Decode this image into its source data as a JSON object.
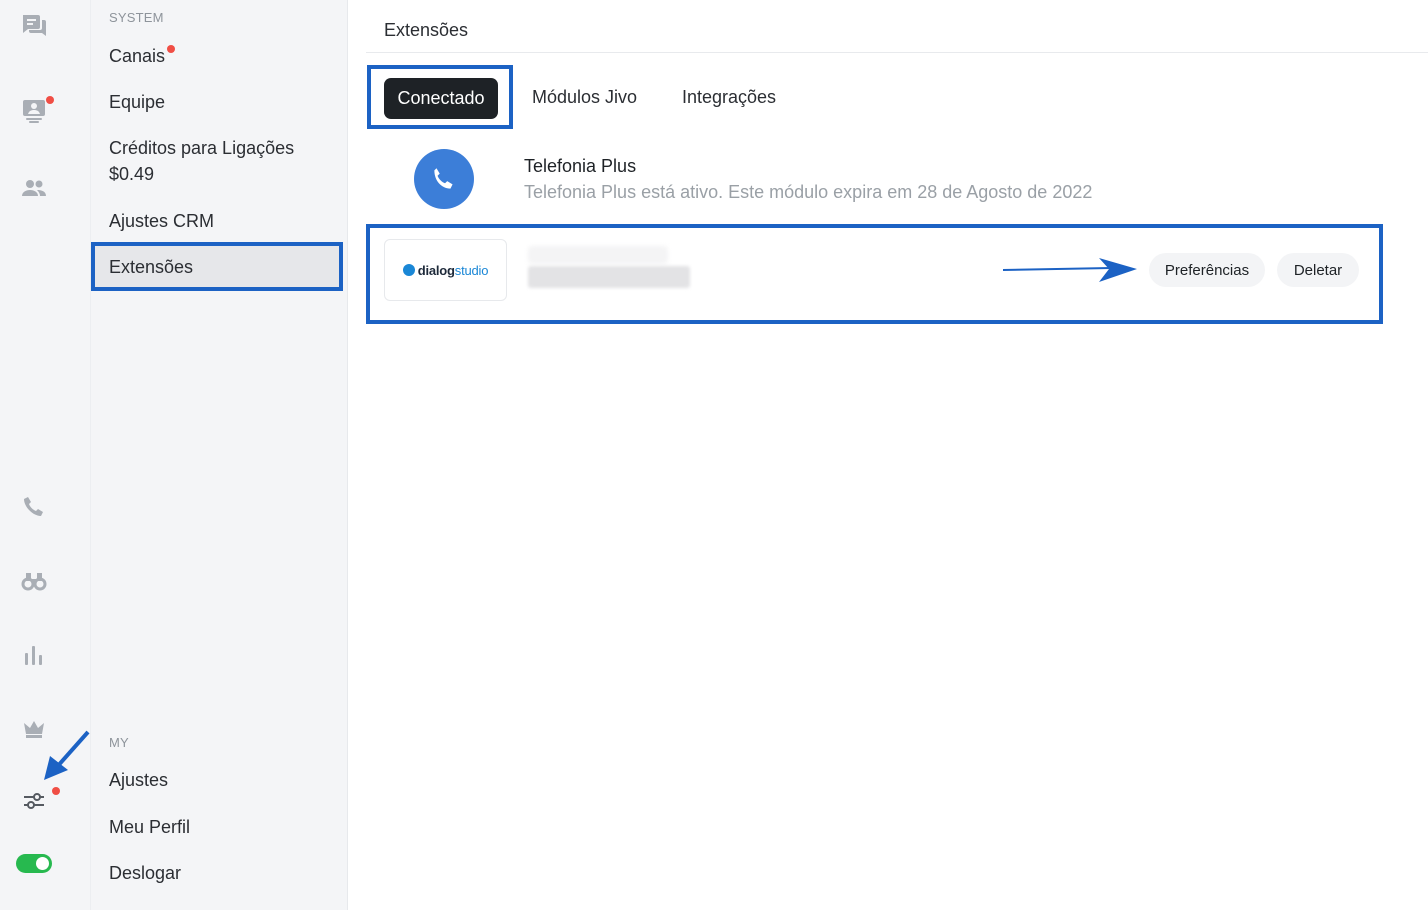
{
  "rail": {
    "icons": [
      "chat-icon",
      "monitor-user-icon",
      "team-icon",
      "phone-icon",
      "binoculars-icon",
      "stats-icon",
      "crown-icon",
      "sliders-icon"
    ],
    "toggle_state": "on",
    "accent": "#27b94f",
    "dot_color": "#f04e45"
  },
  "nav": {
    "system_label": "SYSTEM",
    "items": [
      {
        "label": "Canais"
      },
      {
        "label": "Equipe"
      },
      {
        "label": "Créditos para Ligações"
      },
      {
        "label": "Ajustes CRM"
      },
      {
        "label": "Extensões"
      }
    ],
    "credits_value": "$0.49",
    "my_label": "MY",
    "my_items": [
      {
        "label": "Ajustes"
      },
      {
        "label": "Meu Perfil"
      },
      {
        "label": "Deslogar"
      }
    ]
  },
  "main": {
    "title": "Extensões",
    "tabs": [
      {
        "label": "Conectado"
      },
      {
        "label": "Módulos Jivo"
      },
      {
        "label": "Integrações"
      }
    ],
    "modules": [
      {
        "name": "Telefonia Plus",
        "description": "Telefonia Plus está ativo. Este módulo expira em 28 de Agosto de 2022"
      },
      {
        "logo_text_bold": "dialog",
        "logo_text_light": "studio",
        "actions": [
          {
            "label": "Preferências"
          },
          {
            "label": "Deletar"
          }
        ]
      }
    ]
  },
  "colors": {
    "highlight": "#1c62c4",
    "active_tab_bg": "#1e2226",
    "phone_logo": "#3c7ed8",
    "dialogstudio_blue": "#1a87d6"
  }
}
